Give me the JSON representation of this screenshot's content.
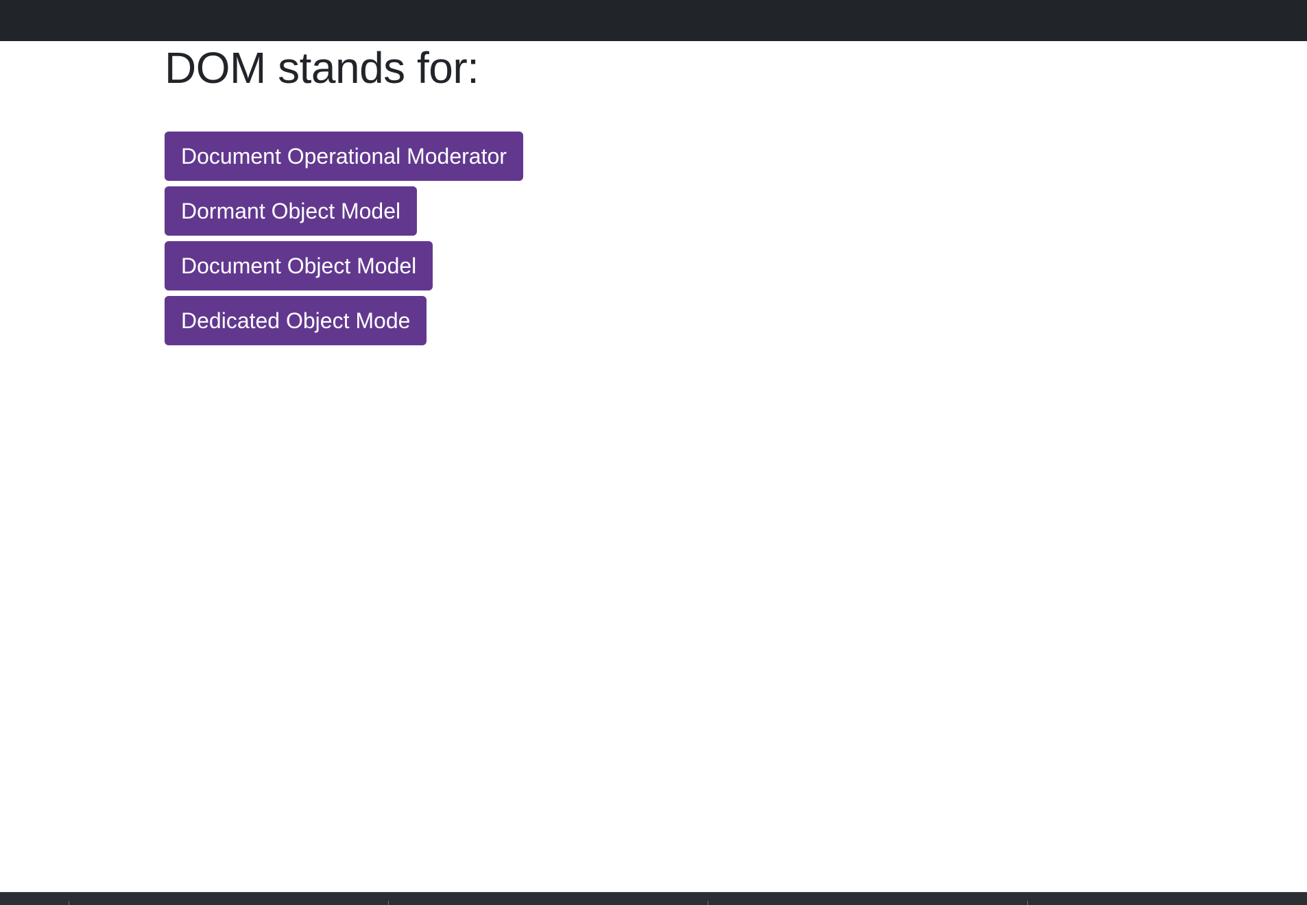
{
  "quiz": {
    "question": "DOM stands for:",
    "answers": [
      "Document Operational Moderator",
      "Dormant Object Model",
      "Document Object Model",
      "Dedicated Object Mode"
    ],
    "button_color": "#62388f"
  },
  "colors": {
    "topbar": "#212529",
    "background": "#ffffff",
    "text": "#212529"
  }
}
